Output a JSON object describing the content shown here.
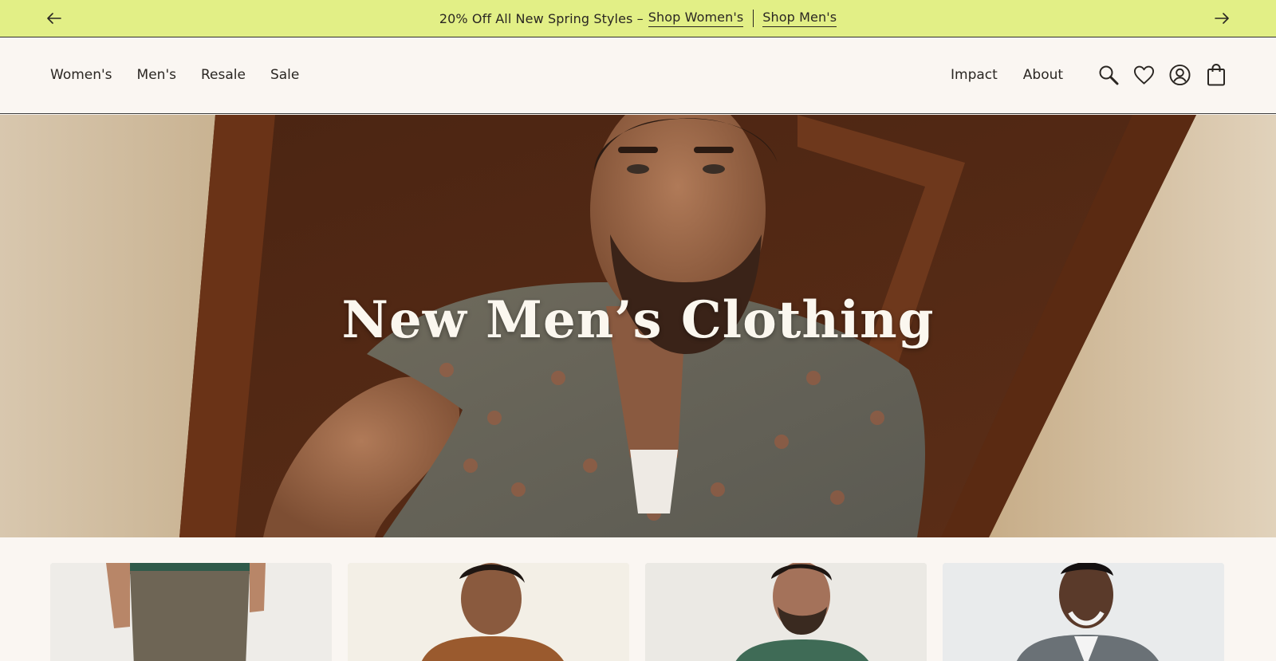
{
  "announcement": {
    "prev_icon": "arrow-left-icon",
    "next_icon": "arrow-right-icon",
    "promo_text": "20% Off All New Spring Styles –",
    "link_women": "Shop Women's",
    "link_men": "Shop Men's"
  },
  "nav": {
    "primary": [
      {
        "label": "Women's"
      },
      {
        "label": "Men's"
      },
      {
        "label": "Resale"
      },
      {
        "label": "Sale"
      }
    ],
    "secondary": [
      {
        "label": "Impact"
      },
      {
        "label": "About"
      }
    ],
    "icons": [
      "search-icon",
      "heart-icon",
      "account-icon",
      "bag-icon"
    ]
  },
  "hero": {
    "title": "New Men’s Clothing"
  },
  "colors": {
    "announcement_bg": "#e2ef86",
    "page_bg": "#faf6f2",
    "text": "#2a2622",
    "hero_title": "#fbf7ef"
  }
}
